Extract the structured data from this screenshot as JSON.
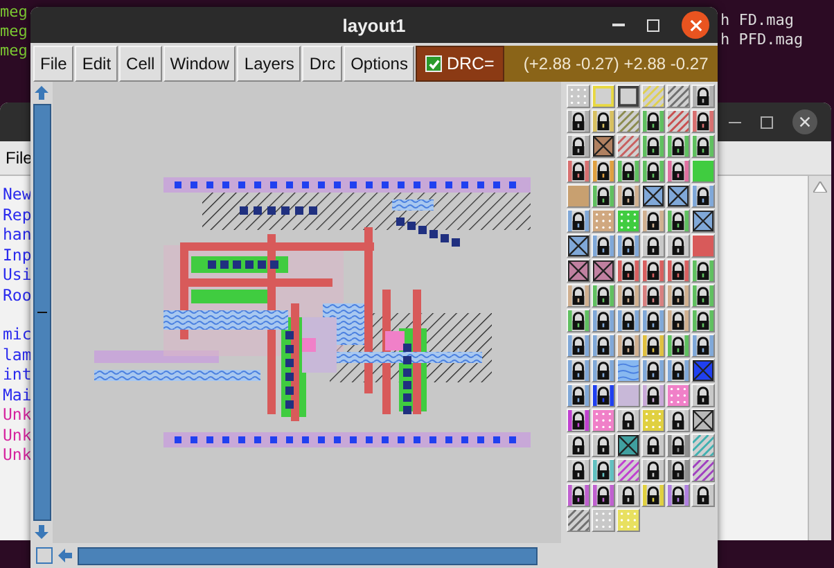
{
  "terminal": {
    "left_lines": [
      "meg",
      "meg",
      "meg"
    ],
    "right_lines": [
      "h FD.mag",
      "h PFD.mag"
    ]
  },
  "back_window": {
    "menu": [
      "File"
    ],
    "blocks": [
      [
        {
          "text": "New",
          "color": "#2a2aee"
        },
        {
          "text": "Rep",
          "color": "#2a2aee"
        },
        {
          "text": "han",
          "color": "#2a2aee"
        },
        {
          "text": "Inp",
          "color": "#2a2aee"
        },
        {
          "text": "Usi",
          "color": "#2a2aee"
        },
        {
          "text": "Roo",
          "color": "#2a2aee"
        }
      ],
      [
        {
          "text": "mic",
          "color": "#2a2aee"
        },
        {
          "text": "lam",
          "color": "#2a2aee"
        },
        {
          "text": "int",
          "color": "#2a2aee"
        },
        {
          "text": "Mai",
          "color": "#2a2aee"
        },
        {
          "text": "Unk",
          "color": "#d6249f"
        },
        {
          "text": "Unk",
          "color": "#d6249f"
        },
        {
          "text": "Unk",
          "color": "#d6249f"
        }
      ]
    ]
  },
  "window": {
    "title": "layout1"
  },
  "menu": [
    "File",
    "Edit",
    "Cell",
    "Window",
    "Layers",
    "Drc",
    "Options"
  ],
  "drc": {
    "label": "DRC=",
    "checked": true
  },
  "coordinates": "(+2.88 -0.27) +2.88 -0.27",
  "palette": [
    [
      {
        "kind": "dots",
        "color": "#c8c8c8"
      },
      {
        "kind": "outline",
        "color": "#e8d840"
      },
      {
        "kind": "outline",
        "color": "#404040"
      },
      {
        "kind": "hatch",
        "color": "#e0d050"
      },
      {
        "kind": "hatch",
        "color": "#707070"
      },
      {
        "kind": "lock",
        "color": "#b0b0b0"
      }
    ],
    [
      {
        "kind": "lock",
        "color": "#b0b0b0"
      },
      {
        "kind": "lock",
        "color": "#d8c060"
      },
      {
        "kind": "hatch",
        "color": "#8c8c50"
      },
      {
        "kind": "lock",
        "color": "#60c060"
      },
      {
        "kind": "hatch",
        "color": "#c85050"
      },
      {
        "kind": "lock",
        "color": "#d87070"
      }
    ],
    [
      {
        "kind": "lock",
        "color": "#b0b0b0"
      },
      {
        "kind": "cross",
        "color": "#b08060"
      },
      {
        "kind": "hatch",
        "color": "#c86060"
      },
      {
        "kind": "lock",
        "color": "#60c060"
      },
      {
        "kind": "lock",
        "color": "#60c060"
      },
      {
        "kind": "lock",
        "color": "#60c060"
      }
    ],
    [
      {
        "kind": "lock",
        "color": "#d87070"
      },
      {
        "kind": "lock",
        "color": "#e0a040"
      },
      {
        "kind": "lock",
        "color": "#60c060"
      },
      {
        "kind": "lock",
        "color": "#60c060"
      },
      {
        "kind": "lock",
        "color": "#e070a0"
      },
      {
        "kind": "solid",
        "color": "#40cc40"
      }
    ],
    [
      {
        "kind": "solid",
        "color": "#c8a070"
      },
      {
        "kind": "lock",
        "color": "#60c060"
      },
      {
        "kind": "lock",
        "color": "#d0b090"
      },
      {
        "kind": "cross",
        "color": "#80a8d8"
      },
      {
        "kind": "cross",
        "color": "#80a8d8"
      },
      {
        "kind": "lock",
        "color": "#80a8d8"
      }
    ],
    [
      {
        "kind": "lock",
        "color": "#80a8d8"
      },
      {
        "kind": "dots",
        "color": "#d0a880"
      },
      {
        "kind": "dots",
        "color": "#40cc40"
      },
      {
        "kind": "lock",
        "color": "#d0b090"
      },
      {
        "kind": "lock",
        "color": "#60c060"
      },
      {
        "kind": "cross",
        "color": "#80a8d8"
      }
    ],
    [
      {
        "kind": "cross",
        "color": "#80a8d8"
      },
      {
        "kind": "lock",
        "color": "#80a8d8"
      },
      {
        "kind": "lock",
        "color": "#80a8d8"
      },
      {
        "kind": "lock",
        "color": "#c8c8c8"
      },
      {
        "kind": "lock",
        "color": "#c8c8c8"
      },
      {
        "kind": "solid",
        "color": "#d85a5a"
      }
    ],
    [
      {
        "kind": "cross",
        "color": "#c080a0"
      },
      {
        "kind": "cross",
        "color": "#c080a0"
      },
      {
        "kind": "lock",
        "color": "#d86060"
      },
      {
        "kind": "lock",
        "color": "#d86060"
      },
      {
        "kind": "lock",
        "color": "#d86060"
      },
      {
        "kind": "lock",
        "color": "#60c060"
      }
    ],
    [
      {
        "kind": "lock",
        "color": "#d0b090"
      },
      {
        "kind": "lock",
        "color": "#60c060"
      },
      {
        "kind": "lock",
        "color": "#d0b090"
      },
      {
        "kind": "lock",
        "color": "#d88080"
      },
      {
        "kind": "lock",
        "color": "#d0b090"
      },
      {
        "kind": "lock",
        "color": "#60c060"
      }
    ],
    [
      {
        "kind": "lock",
        "color": "#60c060"
      },
      {
        "kind": "lock",
        "color": "#80a8d8"
      },
      {
        "kind": "lock",
        "color": "#80a8d8"
      },
      {
        "kind": "lock",
        "color": "#80a8d8"
      },
      {
        "kind": "lock",
        "color": "#d0b090"
      },
      {
        "kind": "lock",
        "color": "#60c060"
      }
    ],
    [
      {
        "kind": "lock",
        "color": "#80a8d8"
      },
      {
        "kind": "lock",
        "color": "#80a8d8"
      },
      {
        "kind": "lock",
        "color": "#d0b090"
      },
      {
        "kind": "lock",
        "color": "#e0c040"
      },
      {
        "kind": "lock",
        "color": "#60c060"
      },
      {
        "kind": "lock",
        "color": "#80a8d8"
      }
    ],
    [
      {
        "kind": "lock",
        "color": "#80a8d8"
      },
      {
        "kind": "lock",
        "color": "#80a8d8"
      },
      {
        "kind": "wave",
        "color": "#88b8f0"
      },
      {
        "kind": "lock",
        "color": "#80a8d8"
      },
      {
        "kind": "lock",
        "color": "#80a8d8"
      },
      {
        "kind": "cross",
        "color": "#2040f0"
      }
    ],
    [
      {
        "kind": "lock",
        "color": "#80a8d8"
      },
      {
        "kind": "lock",
        "color": "#2040f0"
      },
      {
        "kind": "solid",
        "color": "#c8b8d8"
      },
      {
        "kind": "lock",
        "color": "#c8a8d8"
      },
      {
        "kind": "dots",
        "color": "#f080c8"
      },
      {
        "kind": "lock",
        "color": "#c8c8c8"
      }
    ],
    [
      {
        "kind": "lock",
        "color": "#c040d0"
      },
      {
        "kind": "dots",
        "color": "#f080c8"
      },
      {
        "kind": "lock",
        "color": "#c8c8c8"
      },
      {
        "kind": "dots",
        "color": "#e0d040"
      },
      {
        "kind": "lock",
        "color": "#c8c8c8"
      },
      {
        "kind": "cross",
        "color": "#b8b8b8"
      }
    ],
    [
      {
        "kind": "lock",
        "color": "#c8c8c8"
      },
      {
        "kind": "lock",
        "color": "#c8c8c8"
      },
      {
        "kind": "cross",
        "color": "#40a0a0"
      },
      {
        "kind": "lock",
        "color": "#c8c8c8"
      },
      {
        "kind": "lock",
        "color": "#909090"
      },
      {
        "kind": "hatch",
        "color": "#40b0b0"
      }
    ],
    [
      {
        "kind": "lock",
        "color": "#c8c8c8"
      },
      {
        "kind": "lock",
        "color": "#60c0c0"
      },
      {
        "kind": "hatch",
        "color": "#c040d0"
      },
      {
        "kind": "lock",
        "color": "#c8c8c8"
      },
      {
        "kind": "lock",
        "color": "#909090"
      },
      {
        "kind": "hatch",
        "color": "#a040c0"
      }
    ],
    [
      {
        "kind": "lock",
        "color": "#c060d0"
      },
      {
        "kind": "lock",
        "color": "#c060d0"
      },
      {
        "kind": "lock",
        "color": "#c8c8c8"
      },
      {
        "kind": "lock",
        "color": "#e0d040"
      },
      {
        "kind": "lock",
        "color": "#b080e0"
      },
      {
        "kind": "lock",
        "color": "#c8c8c8"
      }
    ],
    [
      {
        "kind": "hatch",
        "color": "#707070"
      },
      {
        "kind": "dots",
        "color": "#c8c8c8"
      },
      {
        "kind": "dots",
        "color": "#e8e060"
      }
    ]
  ]
}
